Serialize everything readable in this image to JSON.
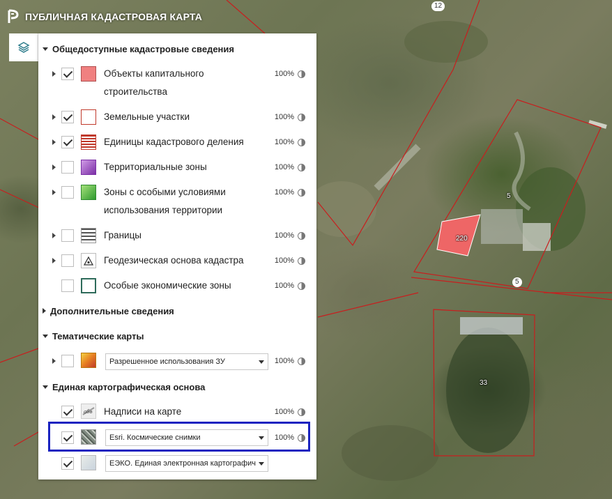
{
  "app": {
    "title": "ПУБЛИЧНАЯ КАДАСТРОВАЯ КАРТА"
  },
  "map": {
    "labels": {
      "top": "12",
      "parcel_5": "5",
      "building_220": "220",
      "road_5": "5",
      "parcel_33": "33"
    },
    "colors": {
      "parcel_border": "#c81e1e",
      "building_fill": "#ee6666"
    }
  },
  "panel": {
    "sections": {
      "public": "Общедоступные кадастровые сведения",
      "additional": "Дополнительные сведения",
      "thematic": "Тематические карты",
      "base": "Единая картографическая основа"
    },
    "layers": [
      {
        "line1": "Объекты капитального",
        "line2": "строительства",
        "opacity": "100%",
        "checked": true,
        "icon": "capital-objects-swatch"
      },
      {
        "line1": "Земельные участки",
        "opacity": "100%",
        "checked": true,
        "icon": "land-plots-swatch"
      },
      {
        "line1": "Единицы кадастрового деления",
        "opacity": "100%",
        "checked": true,
        "icon": "cadastral-division-swatch"
      },
      {
        "line1": "Территориальные зоны",
        "opacity": "100%",
        "checked": false,
        "icon": "territorial-zones-swatch"
      },
      {
        "line1": "Зоны с особыми условиями",
        "line2": "использования территории",
        "opacity": "100%",
        "checked": false,
        "icon": "special-zones-swatch"
      },
      {
        "line1": "Границы",
        "opacity": "100%",
        "checked": false,
        "icon": "borders-swatch"
      },
      {
        "line1": "Геодезическая основа кадастра",
        "opacity": "100%",
        "checked": false,
        "icon": "geodetic-swatch"
      },
      {
        "line1": "Особые экономические зоны",
        "opacity": "100%",
        "checked": false,
        "icon": "economic-zones-swatch"
      }
    ],
    "thematic": {
      "select_value": "Разрешенное использования ЗУ",
      "opacity": "100%",
      "checked": false
    },
    "base": {
      "labels_layer": {
        "label": "Надписи на карте",
        "opacity": "100%",
        "checked": true
      },
      "satellite": {
        "select_value": "Esri. Космические снимки",
        "opacity": "100%",
        "checked": true
      },
      "ecko": {
        "select_value": "ЕЭКО. Единая электронная картографическ",
        "checked": true
      }
    }
  },
  "annotation": {
    "arrow_color": "#1a23c0",
    "box_color": "#1a23c0"
  }
}
